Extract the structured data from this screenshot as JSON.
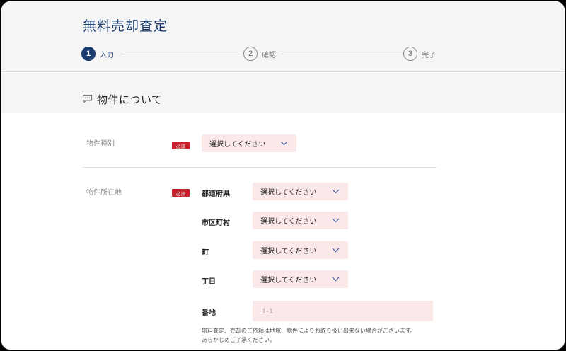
{
  "header": {
    "title": "無料売却査定",
    "steps": [
      {
        "number": "1",
        "label": "入力",
        "active": true
      },
      {
        "number": "2",
        "label": "確認",
        "active": false
      },
      {
        "number": "3",
        "label": "完了",
        "active": false
      }
    ]
  },
  "section": {
    "icon": "speech-bubble-icon",
    "title": "物件について"
  },
  "form": {
    "required_badge": "必須",
    "property_type": {
      "label": "物件種別",
      "select_value": "選択してください"
    },
    "location": {
      "label": "物件所在地",
      "prefecture": {
        "label": "都道府県",
        "select_value": "選択してください"
      },
      "city": {
        "label": "市区町村",
        "select_value": "選択してください"
      },
      "town": {
        "label": "町",
        "select_value": "選択してください"
      },
      "chome": {
        "label": "丁目",
        "select_value": "選択してください"
      },
      "address_number": {
        "label": "番地",
        "placeholder": "1-1",
        "value": ""
      }
    },
    "note_line1": "無料査定、売却のご依頼は地域、物件によりお取り扱い出来ない場合がございます。",
    "note_line2": "あらかじめご了承ください。"
  },
  "colors": {
    "brand": "#1a3b6e",
    "required": "#c8202d",
    "input_bg": "#fbe9e9",
    "chevron": "#3b5b9e"
  }
}
